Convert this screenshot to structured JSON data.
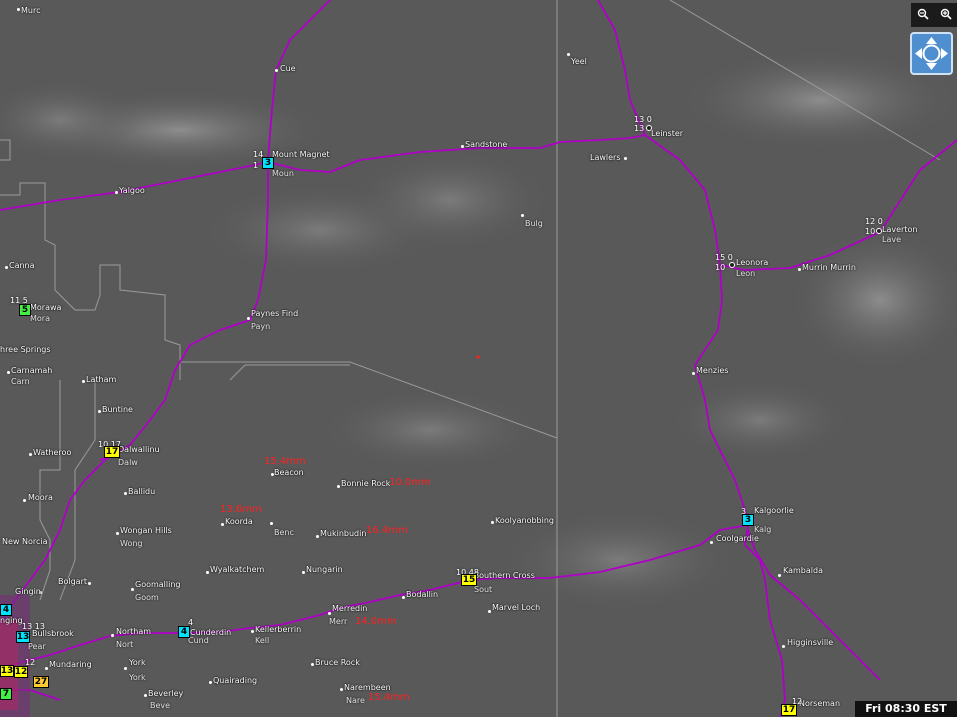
{
  "controls": {
    "zoom_out_icon": "zoom-out-icon",
    "zoom_in_icon": "zoom-in-icon",
    "pan_icon": "pan-arrows-icon"
  },
  "time": "Fri 08:30 EST",
  "colors": {
    "road": "#b000c8",
    "rain": "#ff2020",
    "station_yellow": "#ffff00",
    "station_cyan": "#00e5ff"
  },
  "towns": {
    "murc": "Murc",
    "cue": "Cue",
    "yeel": "Yeel",
    "leinster": "Leinster",
    "lawlers": "Lawlers",
    "mount_magnet": "Mount Magnet",
    "moun": "Moun",
    "sandstone": "Sandstone",
    "yalgoo": "Yalgoo",
    "bulg": "Bulg",
    "laverton": "Laverton",
    "lave": "Lave",
    "leonora": "Leonora",
    "leon": "Leon",
    "murrin_murrin": "Murrin Murrin",
    "canna": "Canna",
    "morawa": "Morawa",
    "mora": "Mora",
    "paynes_find": "Paynes Find",
    "payn": "Payn",
    "three_springs": "hree Springs",
    "carnamah": "Carnamah",
    "carn": "Carn",
    "latham": "Latham",
    "menzies": "Menzies",
    "buntine": "Buntine",
    "dalwallinu": "Dalwallinu",
    "dalw": "Dalw",
    "watheroo": "Watheroo",
    "beacon": "Beacon",
    "moora": "Moora",
    "bonnie_rock": "Bonnie Rock",
    "ballidu": "Ballidu",
    "koorda": "Koorda",
    "benc": "Benc",
    "mukinbudin": "Mukinbudin",
    "koolyanobbing": "Koolyanobbing",
    "kalgoorlie": "Kalgoorlie",
    "kalg": "Kalg",
    "wongan_hills": "Wongan Hills",
    "wong": "Wong",
    "new_norcia": "New Norcia",
    "coolgardie": "Coolgardie",
    "wyalkatchem": "Wyalkatchem",
    "nungarin": "Nungarin",
    "kambalda": "Kambalda",
    "bolgart": "Bolgart",
    "southern_cross": "Southern Cross",
    "sout": "Sout",
    "gingin": "Gingin",
    "goomalling": "Goomalling",
    "goom": "Goom",
    "bodallin": "Bodallin",
    "marvel_loch": "Marvel Loch",
    "bullsbrook": "Bullsbrook",
    "pear": "Pear",
    "northam": "Northam",
    "nort": "Nort",
    "cunderdin": "Cunderdin",
    "cund": "Cund",
    "kellerberrin": "Kellerberrin",
    "kell": "Kell",
    "merredin": "Merredin",
    "merr": "Merr",
    "higginsville": "Higginsville",
    "mundaring": "Mundaring",
    "york": "York",
    "york2": "York",
    "bruce_rock": "Bruce Rock",
    "quairading": "Quairading",
    "norseman": "Norseman",
    "beverley": "Beverley",
    "beve": "Beve",
    "narembeen": "Narembeen",
    "nare": "Nare",
    "nging": "nging"
  },
  "rainfall": {
    "beacon": "15.4mm",
    "bonnie_rock": "10.0mm",
    "koorda": "13.6mm",
    "mukinbudin": "16.4mm",
    "merredin": "14.0mm",
    "narembeen": "15.4mm"
  },
  "stations": {
    "mount_magnet": {
      "badge": "3",
      "top": "14",
      "mid": "1"
    },
    "leinster": {
      "badge": "",
      "top": "13   0",
      "mid": "13"
    },
    "leonora": {
      "badge": "",
      "top": "15   0",
      "mid": "10"
    },
    "laverton": {
      "badge": "",
      "top": "12   0",
      "mid": "10"
    },
    "morawa": {
      "badge": "5",
      "top": "11   5",
      "mid": ""
    },
    "dalwallinu": {
      "badge": "17",
      "top": "10   17",
      "mid": ""
    },
    "kalgoorlie": {
      "badge": "3",
      "top": "3",
      "mid": ""
    },
    "southern_cross": {
      "badge": "15",
      "top": "10  48",
      "mid": ""
    },
    "cunderdin": {
      "badge": "4",
      "top": "4",
      "mid": ""
    },
    "norseman": {
      "badge": "17",
      "top": "12",
      "mid": ""
    },
    "perth_a": {
      "badge": "13",
      "top": "",
      "mid": ""
    },
    "perth_b": {
      "badge": "12",
      "top": "12",
      "mid": ""
    },
    "perth_c": {
      "badge": "27",
      "top": "",
      "mid": ""
    },
    "perth_d": {
      "badge": "7",
      "top": "",
      "mid": ""
    },
    "perth_e": {
      "badge": "4",
      "top": "",
      "mid": ""
    },
    "perth_f": {
      "badge": "13",
      "top": "13 13",
      "mid": ""
    }
  }
}
